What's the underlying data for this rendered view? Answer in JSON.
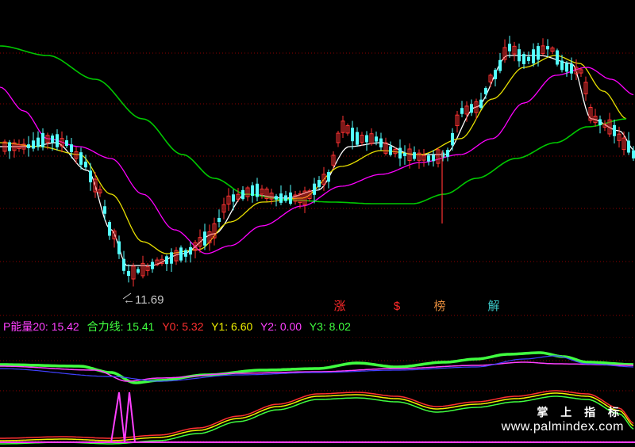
{
  "chart_data": [
    {
      "type": "candlestick",
      "grid": true,
      "annotations": [
        {
          "text": "←11.69",
          "value": 11.69
        }
      ],
      "signals": [
        {
          "label": "涨",
          "color": "#ff2a2a"
        },
        {
          "label": "$",
          "color": "#ff2a2a"
        },
        {
          "label": "榜",
          "color": "#e08a3c"
        },
        {
          "label": "解",
          "color": "#3cc8c8"
        }
      ],
      "series": [
        {
          "color": "#ffffff"
        },
        {
          "color": "#e8e000"
        },
        {
          "color": "#ff00ff"
        },
        {
          "color": "#00c800"
        }
      ]
    },
    {
      "type": "line",
      "indicators": [
        {
          "label": "P能量20: 15.42",
          "color": "#ff40ff"
        },
        {
          "label": "合力线: 15.41",
          "color": "#40ff40"
        },
        {
          "label": "Y0: 5.32",
          "color": "#ff3030"
        },
        {
          "label": "Y1: 6.60",
          "color": "#f0f000"
        },
        {
          "label": "Y2: 0.00",
          "color": "#ff40ff"
        },
        {
          "label": "Y3: 8.02",
          "color": "#40ff40"
        }
      ]
    }
  ],
  "watermark": {
    "title": "掌 上 指 标",
    "url": "www.palmindex.com"
  },
  "colors": {
    "background": "#000000",
    "grid": "#8b0000",
    "up": "#ff3232",
    "down": "#54ffff"
  }
}
